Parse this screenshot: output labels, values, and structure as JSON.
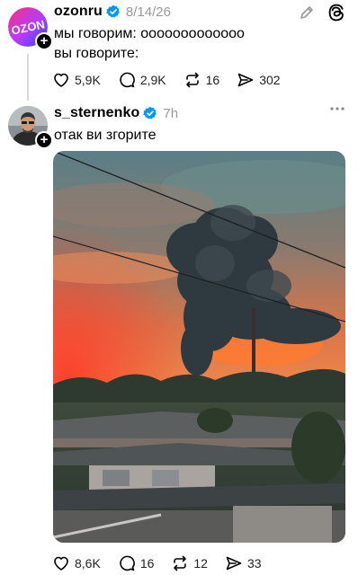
{
  "post1": {
    "username": "ozonru",
    "time": "8/14/26",
    "avatar_text": "OZON",
    "lines": [
      "мы говорим: ооооооооооооо",
      "вы говорите:"
    ],
    "likes": "5,9K",
    "replies": "2,9K",
    "reposts": "16",
    "shares": "302"
  },
  "post2": {
    "username": "s_sternenko",
    "time": "7h",
    "text": "отак ви згорите",
    "likes": "8,6K",
    "replies": "16",
    "reposts": "12",
    "shares": "33"
  },
  "colors": {
    "verified_blue": "#0095f6",
    "ozon_gradient": [
      "#ff2e6e",
      "#2d4bff"
    ],
    "thread_line": "#d9d9d9"
  },
  "icons": [
    "edit-icon",
    "threads-logo-icon",
    "more-icon",
    "heart-icon",
    "comment-icon",
    "repost-icon",
    "share-icon"
  ]
}
